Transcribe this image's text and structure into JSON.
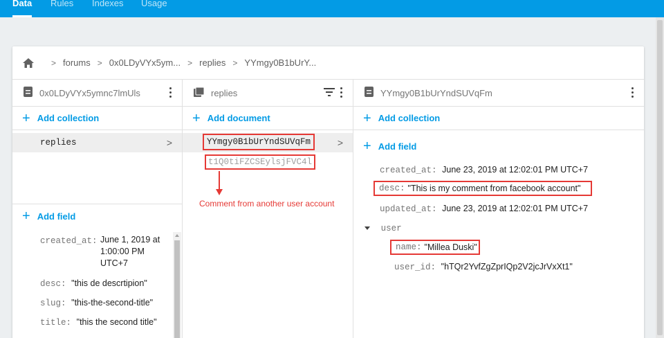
{
  "tabs": [
    {
      "label": "Data",
      "active": true
    },
    {
      "label": "Rules"
    },
    {
      "label": "Indexes"
    },
    {
      "label": "Usage"
    }
  ],
  "breadcrumb": [
    "forums",
    "0x0LDyVYx5ym...",
    "replies",
    "YYmgy0B1bUrY..."
  ],
  "col1": {
    "title": "0x0LDyVYx5ymnc7lmUls",
    "add_collection": "Add collection",
    "collection": "replies",
    "add_field": "Add field",
    "fields": [
      {
        "key": "created_at:",
        "value": "June 1, 2019 at 1:00:00 PM UTC+7"
      },
      {
        "key": "desc:",
        "value": "\"this de descrtipion\""
      },
      {
        "key": "slug:",
        "value": "\"this-the-second-title\""
      },
      {
        "key": "title:",
        "value": "\"this the second title\""
      }
    ]
  },
  "col2": {
    "title": "replies",
    "add_document": "Add document",
    "docs": [
      "YYmgy0B1bUrYndSUVqFm",
      "t1Q0tiFZCSEylsjFVC4l"
    ],
    "annotation": "Comment from another user account"
  },
  "col3": {
    "title": "YYmgy0B1bUrYndSUVqFm",
    "add_collection": "Add collection",
    "add_field": "Add field",
    "fields": [
      {
        "key": "created_at:",
        "value": "June 23, 2019 at 12:02:01 PM UTC+7"
      },
      {
        "key": "desc:",
        "value": "\"This is my comment from facebook account\""
      },
      {
        "key": "updated_at:",
        "value": "June 23, 2019 at 12:02:01 PM UTC+7"
      }
    ],
    "map_key": "user",
    "map_fields": [
      {
        "key": "name:",
        "value": "\"Millea Duski\""
      },
      {
        "key": "user_id:",
        "value": "\"hTQr2YvfZgZprIQp2V2jcJrVxXt1\""
      }
    ]
  },
  "colors": {
    "accent": "#039be5",
    "annotation": "#e53935"
  },
  "icons": [
    "home-icon",
    "document-icon",
    "collection-icon",
    "filter-icon",
    "more-vert-icon",
    "chevron-right-icon",
    "caret-down-icon",
    "plus-icon",
    "arrow-down-icon"
  ]
}
